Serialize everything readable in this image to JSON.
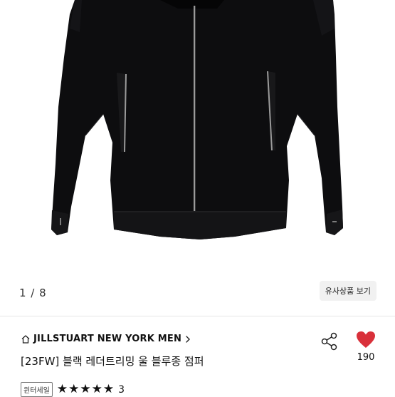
{
  "gallery": {
    "page_indicator": "1 / 8",
    "similar_button_label": "유사상품 보기"
  },
  "product": {
    "brand": "JILLSTUART NEW YORK MEN",
    "title": "[23FW] 블랙 레더트리밍 울 블루종 점퍼",
    "sale_badge": "윈터세일",
    "rating_stars": 5,
    "review_count": "3",
    "like_count": "190"
  },
  "colors": {
    "heart": "#d9303a",
    "jacket": "#0d0d0f",
    "trim": "#8a8a8a",
    "badge_border": "#777777"
  },
  "icons": {
    "brand_home": "home-outline-icon",
    "brand_chevron": "chevron-right-icon",
    "share": "share-icon",
    "like": "heart-filled-icon",
    "star": "star-filled-icon"
  }
}
